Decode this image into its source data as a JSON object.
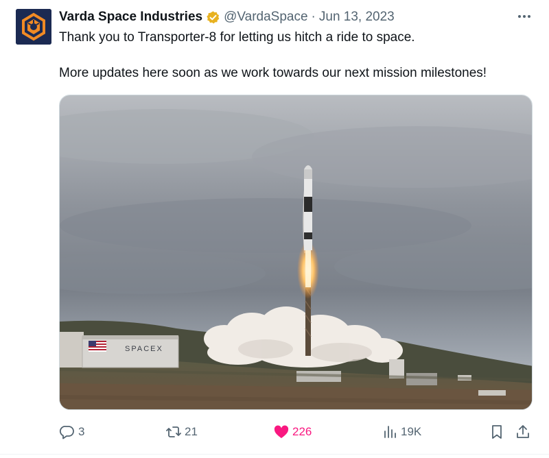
{
  "author": {
    "name": "Varda Space Industries",
    "handle": "@VardaSpace",
    "separator": "·",
    "date": "Jun 13, 2023",
    "avatar_icon": "varda-logo-icon",
    "verified_icon": "verified-badge-icon"
  },
  "more_icon": "more-icon",
  "tweet_text": {
    "line1": "Thank you to Transporter-8 for letting us hitch a ride to space.",
    "line2": "More updates here soon as we work towards our next mission milestones!"
  },
  "media": {
    "building_sign": "SPACEX"
  },
  "actions": {
    "reply": {
      "icon": "reply-icon",
      "count": "3"
    },
    "retweet": {
      "icon": "retweet-icon",
      "count": "21"
    },
    "like": {
      "icon": "heart-icon",
      "count": "226"
    },
    "views": {
      "icon": "views-icon",
      "count": "19K"
    },
    "bookmark": {
      "icon": "bookmark-icon"
    },
    "share": {
      "icon": "share-icon"
    }
  },
  "colors": {
    "text": "#0f1419",
    "secondary": "#536471",
    "like": "#f91880",
    "verified_gold": "#e8b221",
    "avatar_bg": "#1b2a52",
    "logo_orange": "#f08a24"
  }
}
